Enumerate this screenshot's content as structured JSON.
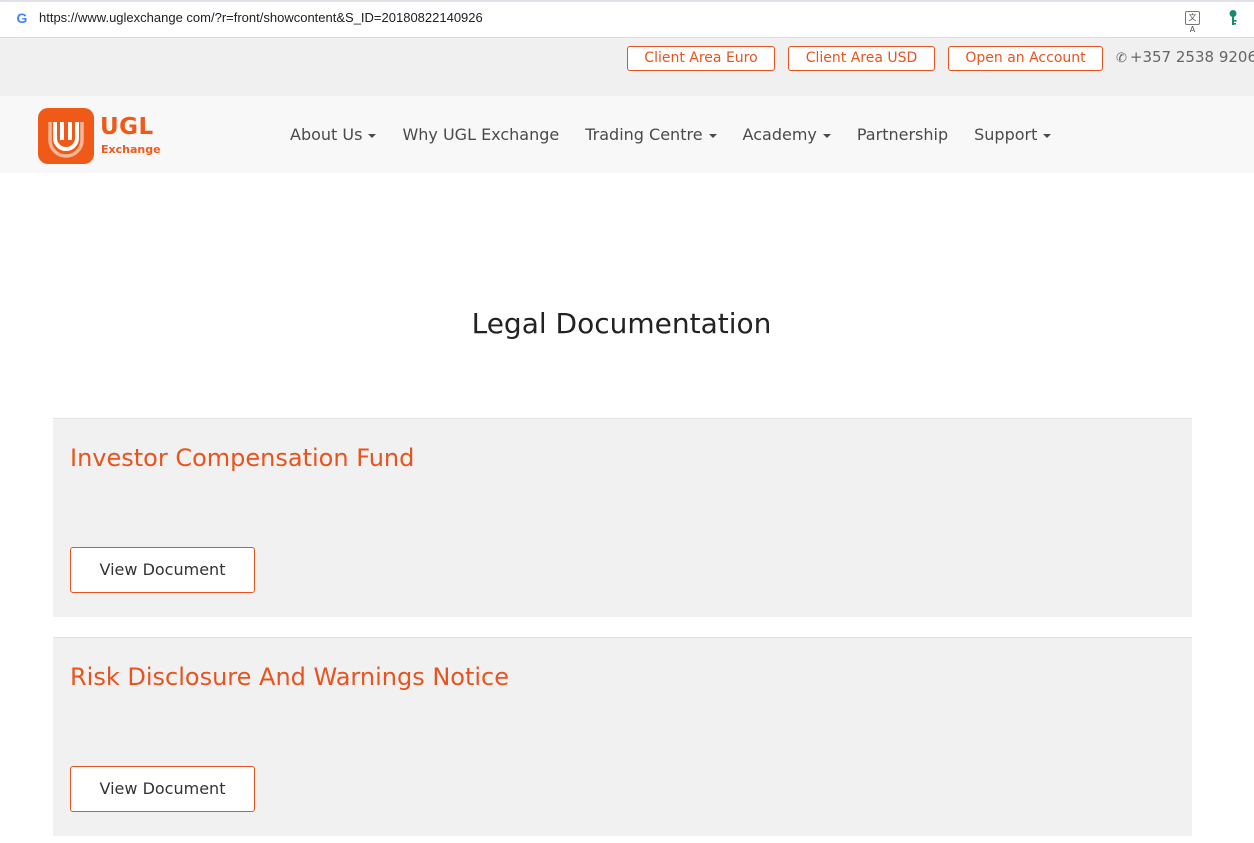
{
  "browser": {
    "url": "https://www.uglexchange com/?r=front/showcontent&S_ID=20180822140926",
    "favicon_icon": "google-g-icon",
    "translate_icon": "translate-icon",
    "extension_icon": "key-icon"
  },
  "topbar": {
    "client_area_euro": "Client Area Euro",
    "client_area_usd": "Client Area USD",
    "open_account": "Open an Account",
    "phone_icon": "phone-icon",
    "phone": "+357 2538 9206"
  },
  "header": {
    "logo_text": "UGL",
    "logo_subtext": "Exchange",
    "nav": [
      {
        "label": "About Us",
        "dropdown": true
      },
      {
        "label": "Why UGL Exchange",
        "dropdown": false
      },
      {
        "label": "Trading Centre",
        "dropdown": true
      },
      {
        "label": "Academy",
        "dropdown": true
      },
      {
        "label": "Partnership",
        "dropdown": false
      },
      {
        "label": "Support",
        "dropdown": true
      }
    ]
  },
  "main": {
    "title": "Legal Documentation",
    "documents": [
      {
        "title": "Investor Compensation Fund",
        "button": "View Document"
      },
      {
        "title": "Risk Disclosure And Warnings Notice",
        "button": "View Document"
      }
    ]
  },
  "colors": {
    "accent": "#e8541e",
    "logo_bg": "#ef5a18",
    "card_bg": "#f1f1f1",
    "topbar_bg": "#f0f0f0",
    "nav_bg": "#f8f8f8"
  }
}
